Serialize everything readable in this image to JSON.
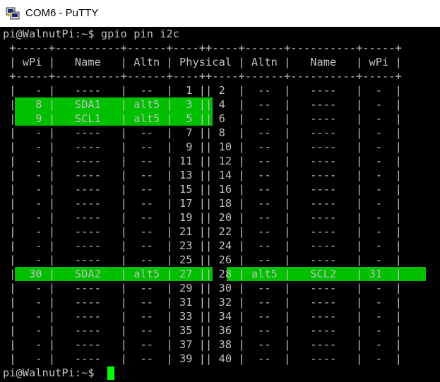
{
  "window": {
    "title": "COM6 - PuTTY",
    "icon": "putty-terminal-icon"
  },
  "colors": {
    "terminal_bg": "#000000",
    "terminal_fg": "#c0c0c0",
    "highlight": "#00c000",
    "cursor": "#00ff00"
  },
  "terminal": {
    "command_line": "pi@WalnutPi:~$ gpio pin i2c",
    "table_lines": [
      " +-----+----------+------+----++----+------+----------+-----+",
      " | wPi |   Name   | Altn | Physical | Altn |   Name   | wPi |",
      " +-----+----------+------+----++----+------+----------+-----+",
      " |   - |   ----   |  --  |  1 || 2  |  --  |   ----   |  -  |",
      " |   8 |   SDA1   | alt5 |  3 || 4  |  --  |   ----   |  -  |",
      " |   9 |   SCL1   | alt5 |  5 || 6  |  --  |   ----   |  -  |",
      " |   - |   ----   |  --  |  7 || 8  |  --  |   ----   |  -  |",
      " |   - |   ----   |  --  |  9 || 10 |  --  |   ----   |  -  |",
      " |   - |   ----   |  --  | 11 || 12 |  --  |   ----   |  -  |",
      " |   - |   ----   |  --  | 13 || 14 |  --  |   ----   |  -  |",
      " |   - |   ----   |  --  | 15 || 16 |  --  |   ----   |  -  |",
      " |   - |   ----   |  --  | 17 || 18 |  --  |   ----   |  -  |",
      " |   - |   ----   |  --  | 19 || 20 |  --  |   ----   |  -  |",
      " |   - |   ----   |  --  | 21 || 22 |  --  |   ----   |  -  |",
      " |   - |   ----   |  --  | 23 || 24 |  --  |   ----   |  -  |",
      " |   - |   ----   |  --  | 25 || 26 |  --  |   ----   |  -  |",
      " |  30 |   SDA2   | alt5 | 27 || 28 | alt5 |   SCL2   | 31  |",
      " |   - |   ----   |  --  | 29 || 30 |  --  |   ----   |  -  |",
      " |   - |   ----   |  --  | 31 || 32 |  --  |   ----   |  -  |",
      " |   - |   ----   |  --  | 33 || 34 |  --  |   ----   |  -  |",
      " |   - |   ----   |  --  | 35 || 36 |  --  |   ----   |  -  |",
      " |   - |   ----   |  --  | 37 || 38 |  --  |   ----   |  -  |",
      " |   - |   ----   |  --  | 39 || 40 |  --  |   ----   |  -  |"
    ],
    "prompt_line": "pi@WalnutPi:~$ "
  }
}
